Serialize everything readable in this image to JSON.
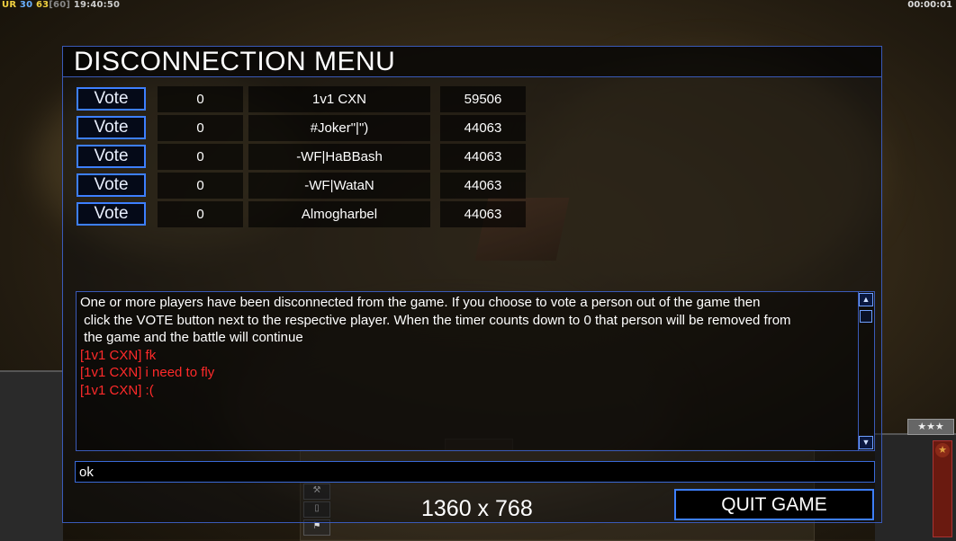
{
  "hud": {
    "ur": "UR",
    "n1": "30",
    "n2": "63",
    "n3": "[60]",
    "clock": "19:40:50",
    "timer": "00:00:01",
    "rank_stars": "★★★"
  },
  "dialog": {
    "title": "DISCONNECTION MENU",
    "vote_label": "Vote",
    "players": [
      {
        "timer": "0",
        "name": "1v1 CXN",
        "ping": "59506"
      },
      {
        "timer": "0",
        "name": "#Joker\"|\")",
        "ping": "44063"
      },
      {
        "timer": "0",
        "name": "-WF|HaBBash",
        "ping": "44063"
      },
      {
        "timer": "0",
        "name": "-WF|WataN",
        "ping": "44063"
      },
      {
        "timer": "0",
        "name": "Almogharbel",
        "ping": "44063"
      }
    ],
    "chat": [
      {
        "text": "One or more players have been disconnected from the game. If you choose to vote a person out of the game then",
        "color": "white"
      },
      {
        "text": " click the VOTE button next to the respective player. When the timer counts down to 0 that person will be removed from",
        "color": "white"
      },
      {
        "text": " the game and the battle will continue",
        "color": "white"
      },
      {
        "text": "[1v1 CXN] fk",
        "color": "red"
      },
      {
        "text": "[1v1 CXN] i need to fly",
        "color": "red"
      },
      {
        "text": "[1v1 CXN] :(",
        "color": "red"
      }
    ],
    "chat_input_value": "ok",
    "resolution": "1360 x 768",
    "quit_label": "QUIT GAME"
  },
  "colors": {
    "accent_blue": "#3d7fff",
    "chat_red": "#ff2a2a"
  }
}
